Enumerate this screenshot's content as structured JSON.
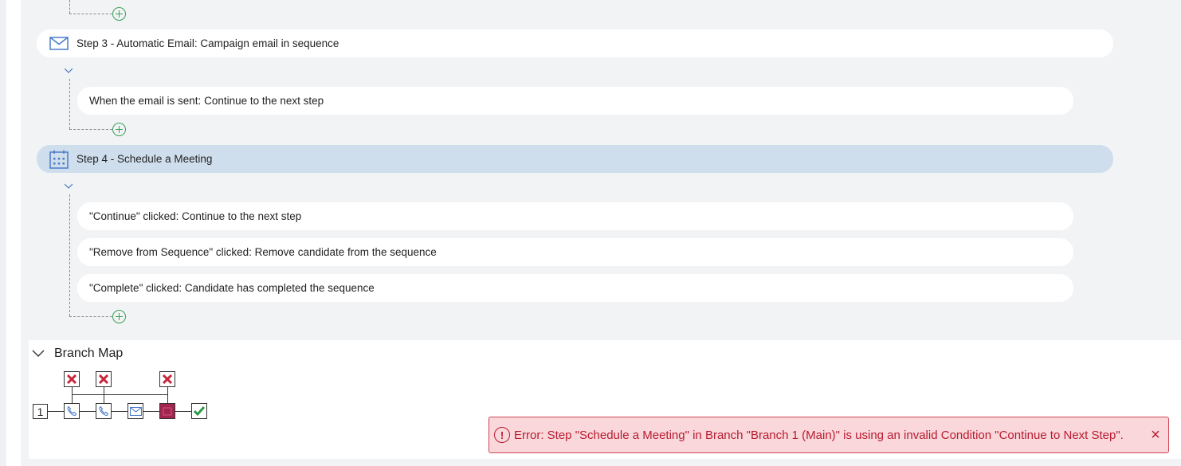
{
  "steps": {
    "step3": {
      "label": "Step 3 - Automatic Email: Campaign email in sequence",
      "icon": "envelope-icon",
      "conditions": [
        "When the email is sent: Continue to the next step"
      ]
    },
    "step4": {
      "label": "Step 4 - Schedule a Meeting",
      "icon": "calendar-icon",
      "conditions": [
        "\"Continue\" clicked: Continue to the next step",
        "\"Remove from Sequence\" clicked: Remove candidate from the sequence",
        "\"Complete\" clicked: Candidate has completed the sequence"
      ]
    }
  },
  "branch_map": {
    "title": "Branch Map",
    "branch_number": "1",
    "nodes": [
      "phone-icon",
      "phone-icon",
      "envelope-icon",
      "meeting-node",
      "check-icon"
    ],
    "end_markers": [
      "x-icon",
      "x-icon",
      "x-icon"
    ]
  },
  "error": {
    "message": "Error: Step \"Schedule a Meeting\" in Branch \"Branch 1 (Main)\" is using an invalid Condition \"Continue to Next Step\".",
    "close_glyph": "×"
  },
  "colors": {
    "accent_green": "#3aa057",
    "active_step_bg": "#cfdeed",
    "error_red": "#b81c31",
    "error_bg": "#f9d7da",
    "meeting_node": "#a3254f",
    "icon_blue": "#4a7bc8"
  }
}
